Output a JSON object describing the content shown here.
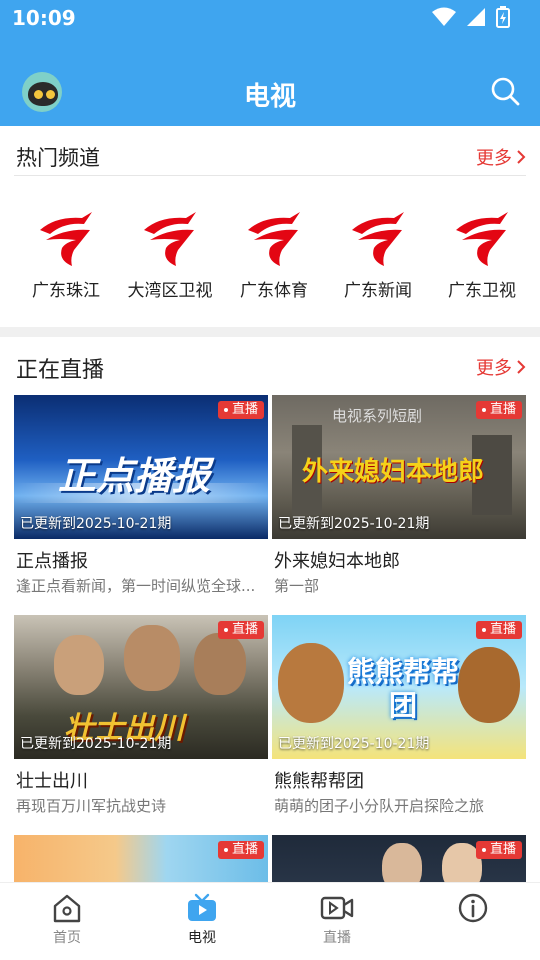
{
  "status_bar": {
    "time": "10:09"
  },
  "header": {
    "title": "电视"
  },
  "hot_channels": {
    "label": "热门频道",
    "more": "更多",
    "channels": [
      {
        "name": "广东珠江"
      },
      {
        "name": "大湾区卫视"
      },
      {
        "name": "广东体育"
      },
      {
        "name": "广东新闻"
      },
      {
        "name": "广东卫视"
      }
    ]
  },
  "live": {
    "label": "正在直播",
    "more": "更多",
    "items": [
      {
        "badge": "直播",
        "updated": "已更新到2025-10-21期",
        "title": "正点播报",
        "desc": "逢正点看新闻，第一时间纵览全球...",
        "art_text": "正点播报"
      },
      {
        "badge": "直播",
        "updated": "已更新到2025-10-21期",
        "title": "外来媳妇本地郎",
        "desc": "第一部",
        "art_text": "外来媳妇本地郎",
        "art_top": "电视系列短剧"
      },
      {
        "badge": "直播",
        "updated": "已更新到2025-10-21期",
        "title": "壮士出川",
        "desc": "再现百万川军抗战史诗",
        "art_text": "壮士出川"
      },
      {
        "badge": "直播",
        "updated": "已更新到2025-10-21期",
        "title": "熊熊帮帮团",
        "desc": "萌萌的团子小分队开启探险之旅",
        "art_text": "熊熊帮帮团"
      },
      {
        "badge": "直播"
      },
      {
        "badge": "直播"
      }
    ]
  },
  "bottom_nav": [
    {
      "label": "首页"
    },
    {
      "label": "电视"
    },
    {
      "label": "直播"
    },
    {
      "label": ""
    }
  ],
  "colors": {
    "primary": "#3fa5ef",
    "accent_red": "#e53935",
    "logo_red": "#e30613"
  }
}
